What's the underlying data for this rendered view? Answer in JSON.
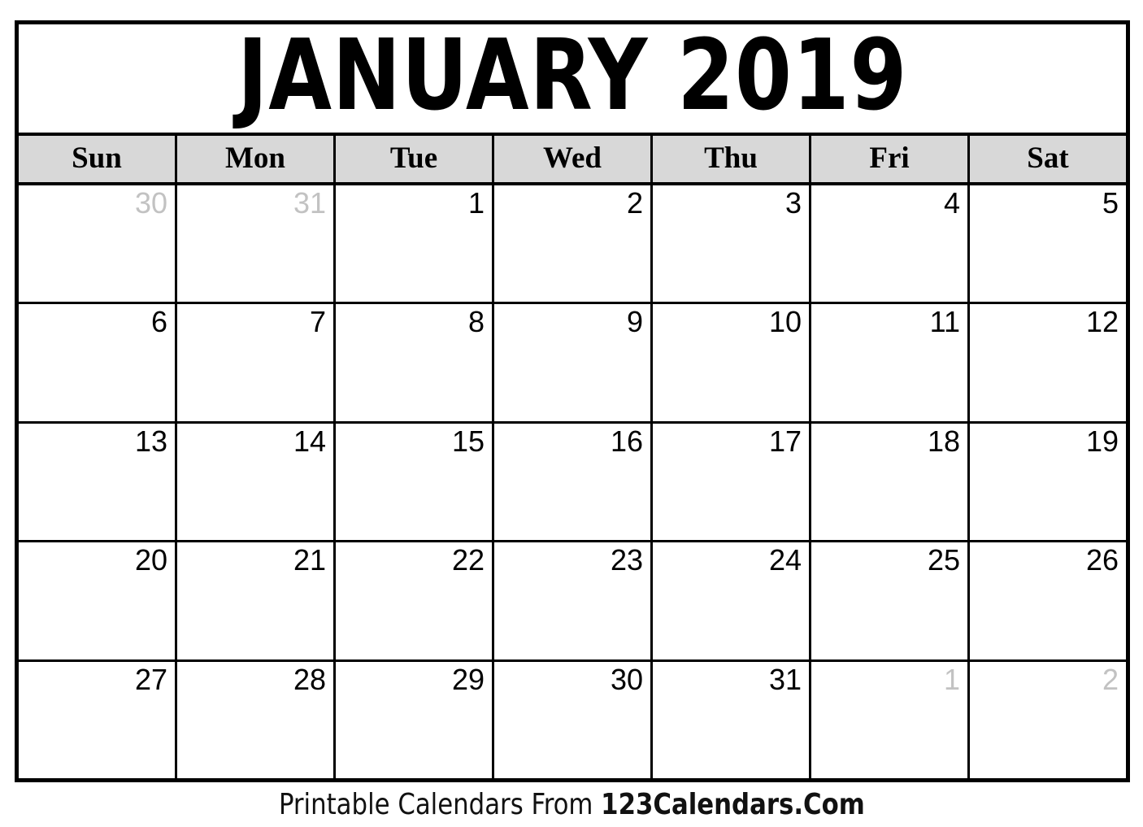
{
  "calendar": {
    "title": "JANUARY 2019",
    "month": "January",
    "year": "2019",
    "colors": {
      "border": "#000000",
      "header_background": "#d8d8d8",
      "background": "#ffffff",
      "date_text": "#000000",
      "outside_date_text": "#c2c2c2"
    },
    "weekday_headers": [
      {
        "label": "Sun"
      },
      {
        "label": "Mon"
      },
      {
        "label": "Tue"
      },
      {
        "label": "Wed"
      },
      {
        "label": "Thu"
      },
      {
        "label": "Fri"
      },
      {
        "label": "Sat"
      }
    ],
    "weeks": [
      [
        {
          "day": "30",
          "outside": true
        },
        {
          "day": "31",
          "outside": true
        },
        {
          "day": "1",
          "outside": false
        },
        {
          "day": "2",
          "outside": false
        },
        {
          "day": "3",
          "outside": false
        },
        {
          "day": "4",
          "outside": false
        },
        {
          "day": "5",
          "outside": false
        }
      ],
      [
        {
          "day": "6",
          "outside": false
        },
        {
          "day": "7",
          "outside": false
        },
        {
          "day": "8",
          "outside": false
        },
        {
          "day": "9",
          "outside": false
        },
        {
          "day": "10",
          "outside": false
        },
        {
          "day": "11",
          "outside": false
        },
        {
          "day": "12",
          "outside": false
        }
      ],
      [
        {
          "day": "13",
          "outside": false
        },
        {
          "day": "14",
          "outside": false
        },
        {
          "day": "15",
          "outside": false
        },
        {
          "day": "16",
          "outside": false
        },
        {
          "day": "17",
          "outside": false
        },
        {
          "day": "18",
          "outside": false
        },
        {
          "day": "19",
          "outside": false
        }
      ],
      [
        {
          "day": "20",
          "outside": false
        },
        {
          "day": "21",
          "outside": false
        },
        {
          "day": "22",
          "outside": false
        },
        {
          "day": "23",
          "outside": false
        },
        {
          "day": "24",
          "outside": false
        },
        {
          "day": "25",
          "outside": false
        },
        {
          "day": "26",
          "outside": false
        }
      ],
      [
        {
          "day": "27",
          "outside": false
        },
        {
          "day": "28",
          "outside": false
        },
        {
          "day": "29",
          "outside": false
        },
        {
          "day": "30",
          "outside": false
        },
        {
          "day": "31",
          "outside": false
        },
        {
          "day": "1",
          "outside": true
        },
        {
          "day": "2",
          "outside": true
        }
      ]
    ]
  },
  "footer": {
    "lead_text": "Printable Calendars From ",
    "brand_text": "123Calendars.Com"
  }
}
